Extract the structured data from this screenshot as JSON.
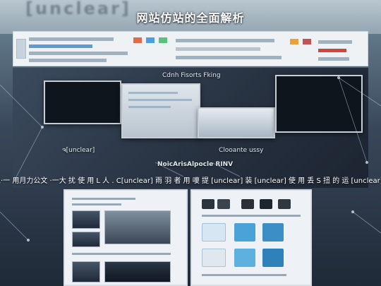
{
  "banner": {
    "background_text": "[unclear]",
    "title": "网站仿站的全面解析"
  },
  "collage": {
    "caption_top": "Cdnh Fisorts Fking",
    "caption_left": "ຈ[unclear]",
    "caption_right": "Clooante ussy",
    "caption_center": "NoicArisAlpocle RINV"
  },
  "strip": {
    "text": "速携 丙以·一 用月力公文 ·一大 扰 使 用 L 人 . C[unclear] 雨 羽 者 用 嗄 提 [unclear] 装 [unclear] 使 用 丢 S 扭 的 运 [unclear] 茗 风 用"
  },
  "colors": {
    "accent": "#4aa3d8",
    "title_text": "#ffffff"
  }
}
